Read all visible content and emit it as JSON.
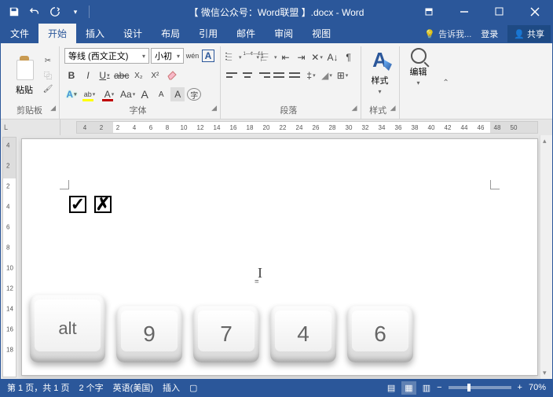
{
  "title": "【 微信公众号：Word联盟 】.docx - Word",
  "menu": {
    "file": "文件",
    "home": "开始",
    "insert": "插入",
    "design": "设计",
    "layout": "布局",
    "references": "引用",
    "mail": "邮件",
    "review": "审阅",
    "view": "视图",
    "tellme": "告诉我...",
    "login": "登录",
    "share": "共享"
  },
  "ribbon": {
    "clipboard": {
      "paste": "粘贴",
      "label": "剪贴板"
    },
    "font": {
      "name": "等线 (西文正文)",
      "size": "小初",
      "bold": "B",
      "italic": "I",
      "underline": "U",
      "strike": "abc",
      "sub": "X₂",
      "sup": "X²",
      "pinyin": "wén",
      "char_border": "A",
      "highlight": "A",
      "color": "A",
      "case": "Aa",
      "grow": "A",
      "shrink": "A",
      "clear": "A",
      "effects": "A",
      "label": "字体"
    },
    "paragraph": {
      "label": "段落"
    },
    "styles": {
      "btn": "样式",
      "label": "样式"
    },
    "editing": {
      "btn": "编辑"
    }
  },
  "ruler": {
    "corner": "L",
    "h": [
      "4",
      "2",
      "2",
      "4",
      "6",
      "8",
      "10",
      "12",
      "14",
      "16",
      "18",
      "20",
      "22",
      "24",
      "26",
      "28",
      "30",
      "32",
      "34",
      "36",
      "38",
      "40",
      "42",
      "44",
      "46",
      "48",
      "50"
    ],
    "v": [
      "4",
      "2",
      "2",
      "4",
      "6",
      "8",
      "10",
      "12",
      "14",
      "16",
      "18"
    ]
  },
  "document": {
    "check": "✓",
    "cross": "✗"
  },
  "keys": {
    "alt": "alt",
    "k1": "9",
    "k2": "7",
    "k3": "4",
    "k4": "6"
  },
  "status": {
    "page": "第 1 页，共 1 页",
    "words": "2 个字",
    "lang": "英语(美国)",
    "mode": "插入",
    "zoom": "70%"
  }
}
